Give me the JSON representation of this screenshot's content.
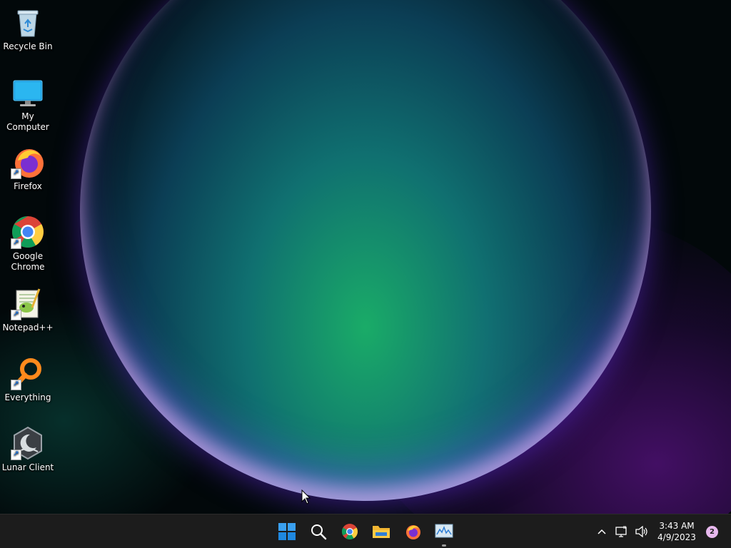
{
  "desktop": {
    "icons": [
      {
        "label": "Recycle Bin",
        "icon": "recycle-bin-icon"
      },
      {
        "label": "My Computer",
        "icon": "computer-icon"
      },
      {
        "label": "Firefox",
        "icon": "firefox-icon"
      },
      {
        "label": "Google Chrome",
        "icon": "chrome-icon"
      },
      {
        "label": "Notepad++",
        "icon": "notepadpp-icon"
      },
      {
        "label": "Everything",
        "icon": "everything-search-icon"
      },
      {
        "label": "Lunar Client",
        "icon": "lunar-client-icon"
      }
    ]
  },
  "taskbar": {
    "apps": [
      "start-icon",
      "search-icon",
      "chrome-icon",
      "file-explorer-icon",
      "firefox-icon",
      "task-manager-icon"
    ],
    "clock": {
      "time": "3:43 AM",
      "date": "4/9/2023"
    },
    "notification_count": "2"
  },
  "colors": {
    "taskbar_bg": "#1c1c1c",
    "accent": "#0078d4",
    "badge": "#e7b8ee"
  }
}
